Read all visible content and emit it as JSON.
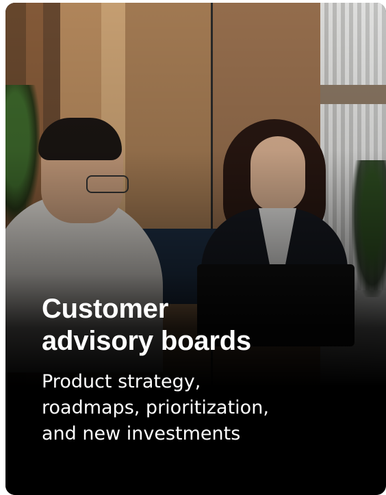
{
  "card": {
    "title": "Customer\nadvisory boards",
    "description": "Product strategy,\nroadmaps, prioritization,\nand new investments",
    "image_description_icon": "meeting-photo"
  },
  "colors": {
    "text": "#ffffff",
    "overlay": "#000000"
  }
}
